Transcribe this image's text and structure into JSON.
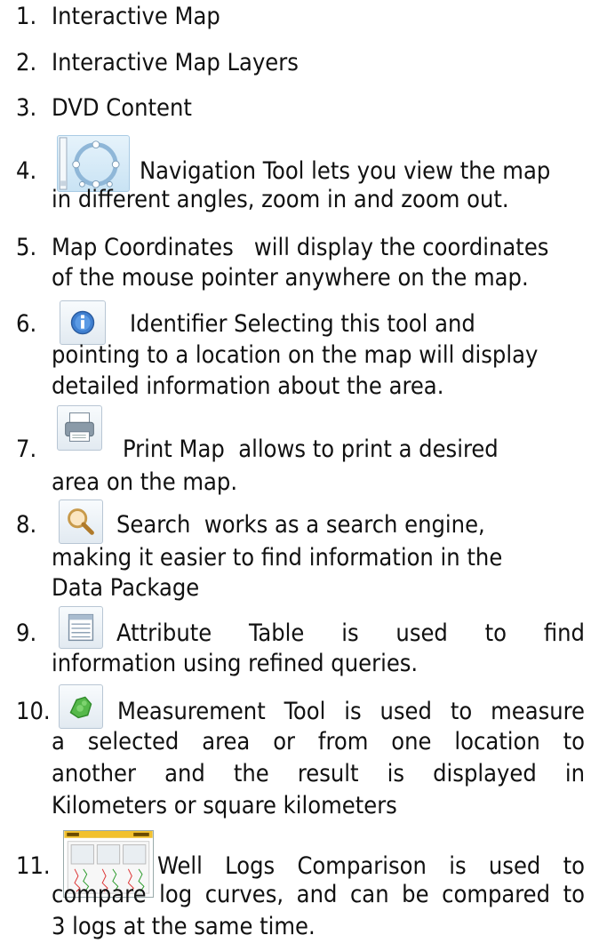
{
  "items": [
    {
      "number": "1.",
      "lines": [
        "Interactive Map"
      ]
    },
    {
      "number": "2.",
      "lines": [
        "Interactive Map Layers"
      ]
    },
    {
      "number": "3.",
      "lines": [
        "DVD Content"
      ]
    },
    {
      "number": "4.",
      "lines": [
        "Navigation Tool  lets you view the map",
        "in different angles, zoom in and zoom out."
      ],
      "icon": "navigation-tool-icon"
    },
    {
      "number": "5.",
      "lines": [
        "Map Coordinates   will display the coordinates",
        "of the mouse pointer anywhere on the map."
      ]
    },
    {
      "number": "6.",
      "lines": [
        "Identifier  Selecting this tool and",
        "pointing to a location on the map will display",
        "detailed information about the area."
      ],
      "icon": "identifier-icon"
    },
    {
      "number": "7.",
      "lines": [
        "Print Map  allows to print a desired",
        "area on the map."
      ],
      "icon": "print-icon"
    },
    {
      "number": "8.",
      "lines": [
        "Search  works as a search engine,",
        "making it easier to find information in the",
        "Data Package"
      ],
      "icon": "search-icon"
    },
    {
      "number": "9.",
      "lines": [
        "Attribute   Table      is   used   to   find",
        "information using refined queries."
      ],
      "icon": "table-icon"
    },
    {
      "number": "10.",
      "lines": [
        "Measurement Tool  is used to measure",
        "a selected area or from one location to",
        "another and the result is displayed in",
        "Kilometers or square kilometers"
      ],
      "icon": "ruler-icon"
    },
    {
      "number": "11.",
      "lines": [
        "Well Logs Comparison  is used to",
        "compare log curves, and can be compared to",
        "3 logs at the same time."
      ],
      "icon": "well-logs-thumbnail-icon"
    }
  ]
}
